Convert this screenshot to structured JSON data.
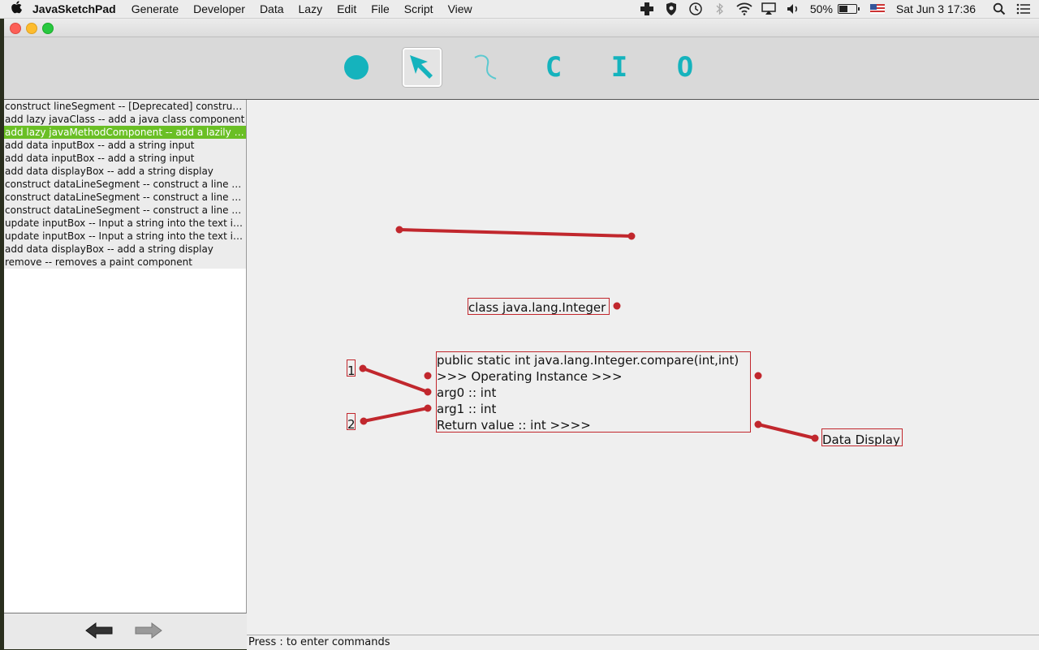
{
  "menubar": {
    "app_name": "JavaSketchPad",
    "menus": [
      "Generate",
      "Developer",
      "Data",
      "Lazy",
      "Edit",
      "File",
      "Script",
      "View"
    ],
    "battery": "50%",
    "datetime": "Sat Jun 3  17:36"
  },
  "toolbar": {
    "tools": [
      {
        "name": "circle-tool",
        "icon": "circle-icon"
      },
      {
        "name": "select-tool",
        "icon": "arrow-cursor-icon",
        "selected": true
      },
      {
        "name": "curve-tool",
        "icon": "curve-icon"
      },
      {
        "name": "c-tool",
        "label": "C"
      },
      {
        "name": "i-tool",
        "label": "I"
      },
      {
        "name": "o-tool",
        "label": "O"
      }
    ]
  },
  "commands": [
    {
      "text": "construct lineSegment -- [Deprecated] construct a line segment"
    },
    {
      "text": "add lazy javaClass -- add a java class component"
    },
    {
      "text": "add lazy javaMethodComponent -- add a lazily evaluated method component",
      "active": true
    },
    {
      "text": "add data inputBox -- add a string input"
    },
    {
      "text": "add data inputBox -- add a string input"
    },
    {
      "text": "add data displayBox -- add a string display"
    },
    {
      "text": "construct dataLineSegment -- construct a line segment"
    },
    {
      "text": "construct dataLineSegment -- construct a line segment"
    },
    {
      "text": "construct dataLineSegment -- construct a line segment"
    },
    {
      "text": "update inputBox -- Input a string into the text input"
    },
    {
      "text": "update inputBox -- Input a string into the text input"
    },
    {
      "text": "add data displayBox -- add a string display"
    },
    {
      "text": "remove -- removes a paint component"
    }
  ],
  "canvas": {
    "class_component": "class java.lang.Integer",
    "method_component": {
      "lines": [
        "public static int java.lang.Integer.compare(int,int)",
        ">>> Operating Instance  >>>",
        "arg0 :: int",
        "arg1 :: int",
        "Return value :: int >>>>"
      ]
    },
    "input_1": "1",
    "input_2": "2",
    "display_box": "Data Display"
  },
  "status": "Press : to enter commands",
  "colors": {
    "accent": "#15b3bd",
    "component": "#c1272d",
    "selection": "#6abf25"
  }
}
